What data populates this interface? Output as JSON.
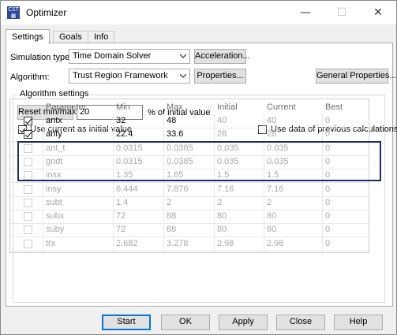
{
  "window": {
    "title": "Optimizer",
    "icon": "cst-app-icon",
    "minimize": "—",
    "maximize": "☐",
    "close": "✕"
  },
  "tabs": [
    {
      "label": "Settings",
      "active": true
    },
    {
      "label": "Goals",
      "active": false
    },
    {
      "label": "Info",
      "active": false
    }
  ],
  "settings": {
    "simulation_type_label": "Simulation type:",
    "simulation_type_value": "Time Domain Solver",
    "acceleration_label": "Acceleration...",
    "algorithm_label": "Algorithm:",
    "algorithm_value": "Trust Region Framework",
    "properties_label": "Properties...",
    "general_properties_label": "General Properties...",
    "group_title": "Algorithm settings",
    "reset_label": "Reset min/max",
    "reset_value": "20",
    "percent_label": "% of initial value",
    "use_current_label": "Use current as initial value",
    "use_current_checked": true,
    "use_previous_label": "Use data of previous calculations",
    "use_previous_checked": false
  },
  "table": {
    "columns": [
      "Parameter",
      "Min",
      "Max",
      "Initial",
      "Current",
      "Best"
    ],
    "rows": [
      {
        "checked": true,
        "param": "antx",
        "min": "32",
        "max": "48",
        "initial": "40",
        "current": "40",
        "best": "0"
      },
      {
        "checked": true,
        "param": "anty",
        "min": "22.4",
        "max": "33.6",
        "initial": "28",
        "current": "28",
        "best": "0"
      },
      {
        "checked": false,
        "param": "ant_t",
        "min": "0.0315",
        "max": "0.0385",
        "initial": "0.035",
        "current": "0.035",
        "best": "0"
      },
      {
        "checked": false,
        "param": "gndt",
        "min": "0.0315",
        "max": "0.0385",
        "initial": "0.035",
        "current": "0.035",
        "best": "0"
      },
      {
        "checked": false,
        "param": "insx",
        "min": "1.35",
        "max": "1.65",
        "initial": "1.5",
        "current": "1.5",
        "best": "0"
      },
      {
        "checked": false,
        "param": "insy",
        "min": "6.444",
        "max": "7.876",
        "initial": "7.16",
        "current": "7.16",
        "best": "0"
      },
      {
        "checked": false,
        "param": "subt",
        "min": "1.4",
        "max": "2",
        "initial": "2",
        "current": "2",
        "best": "0"
      },
      {
        "checked": false,
        "param": "subx",
        "min": "72",
        "max": "88",
        "initial": "80",
        "current": "80",
        "best": "0"
      },
      {
        "checked": false,
        "param": "suby",
        "min": "72",
        "max": "88",
        "initial": "80",
        "current": "80",
        "best": "0"
      },
      {
        "checked": false,
        "param": "trx",
        "min": "2.682",
        "max": "3.278",
        "initial": "2.98",
        "current": "2.98",
        "best": "0"
      }
    ]
  },
  "buttons": {
    "start": "Start",
    "ok": "OK",
    "apply": "Apply",
    "close": "Close",
    "help": "Help"
  }
}
